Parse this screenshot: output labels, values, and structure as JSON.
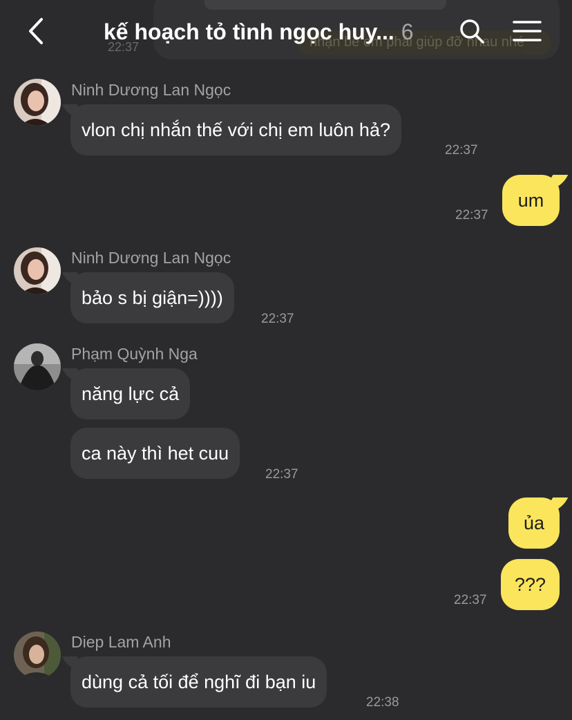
{
  "header": {
    "back_icon": "chevron-left-icon",
    "title": "kế hoạch tỏ tình ngọc huy...",
    "member_count": "6",
    "search_icon": "search-icon",
    "menu_icon": "hamburger-menu-icon"
  },
  "background_ghost": {
    "time": "22:37",
    "preview_text": "nhận be em phải giúp đỡ nhau nhé"
  },
  "messages": [
    {
      "sender": "Ninh Dương Lan Ngọc",
      "text": "vlon chị nhắn thế với chị em luôn hả?",
      "time": "22:37"
    },
    {
      "text": "um",
      "time": "22:37"
    },
    {
      "sender": "Ninh Dương Lan Ngọc",
      "text": "bảo s bị giận=))))",
      "time": "22:37"
    },
    {
      "sender": "Phạm Quỳnh Nga",
      "text": "năng lực cả"
    },
    {
      "text": "ca này thì het cuu",
      "time": "22:37"
    },
    {
      "text": "ủa"
    },
    {
      "text": "???",
      "time": "22:37"
    },
    {
      "sender": "Diep Lam Anh",
      "text": "dùng cả tối để nghĩ đi bạn iu",
      "time": "22:38"
    }
  ],
  "colors": {
    "background": "#2b2b2d",
    "incoming_bubble": "#3b3b3d",
    "outgoing_bubble": "#fbe55c",
    "secondary_text": "#a3a3a5"
  }
}
